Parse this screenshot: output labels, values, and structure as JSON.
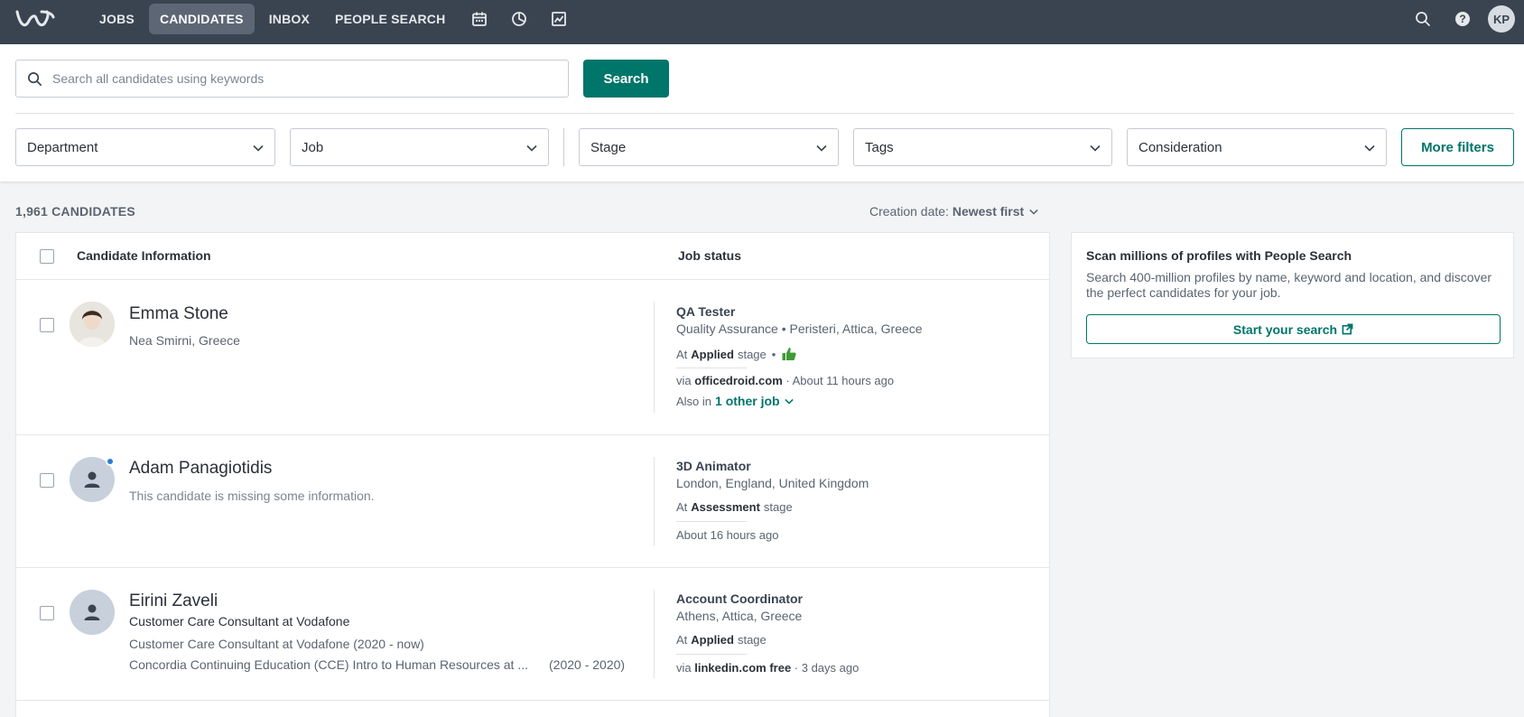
{
  "nav": {
    "items": [
      {
        "label": "JOBS",
        "active": false
      },
      {
        "label": "CANDIDATES",
        "active": true
      },
      {
        "label": "INBOX",
        "active": false
      },
      {
        "label": "PEOPLE SEARCH",
        "active": false
      }
    ],
    "icons": [
      "calendar-icon",
      "pie-chart-icon",
      "reports-icon"
    ],
    "right_icons": [
      "search-icon",
      "help-icon"
    ],
    "user_initials": "KP"
  },
  "search": {
    "placeholder": "Search all candidates using keywords",
    "value": "",
    "button_label": "Search"
  },
  "filters": {
    "department": "Department",
    "job": "Job",
    "stage": "Stage",
    "tags": "Tags",
    "consideration": "Consideration",
    "more_label": "More filters"
  },
  "list": {
    "count": "1,961 CANDIDATES",
    "sort_label": "Creation date:",
    "sort_value": "Newest first",
    "columns": {
      "info": "Candidate Information",
      "status": "Job status"
    }
  },
  "candidates": [
    {
      "name": "Emma Stone",
      "location": "Nea Smirni, Greece",
      "job_title": "QA Tester",
      "job_location": "Quality Assurance • Peristeri, Attica, Greece",
      "stage_prefix": "At",
      "stage": "Applied",
      "stage_suffix": "stage",
      "stage_dot": "•",
      "via_prefix": "via",
      "source": "officedroid.com",
      "time": "· About 11 hours ago",
      "also_prefix": "Also in",
      "also_link": "1 other job"
    },
    {
      "name": "Adam Panagiotidis",
      "missing": "This candidate is missing some information.",
      "job_title": "3D Animator",
      "job_location": "London, England, United Kingdom",
      "stage_prefix": "At",
      "stage": "Assessment",
      "stage_suffix": "stage",
      "time": "About 16 hours ago"
    },
    {
      "name": "Eirini Zaveli",
      "headline": "Customer Care Consultant at Vodafone",
      "experience": "Customer Care Consultant at Vodafone (2020 - now)",
      "education": "Concordia Continuing Education (CCE) Intro to Human Resources at ...",
      "education_years": "(2020 - 2020)",
      "job_title": "Account Coordinator",
      "job_location": "Athens, Attica, Greece",
      "stage_prefix": "At",
      "stage": "Applied",
      "stage_suffix": "stage",
      "via_prefix": "via",
      "source": "linkedin.com free",
      "time": "· 3 days ago"
    }
  ],
  "side_card": {
    "title": "Scan millions of profiles with People Search",
    "text": "Search 400-million profiles by name, keyword and location, and discover the perfect candidates for your job.",
    "button_label": "Start your search"
  },
  "colors": {
    "topbar": "#3a4451",
    "accent": "#00756a",
    "page_bg": "#f3f4f5"
  }
}
